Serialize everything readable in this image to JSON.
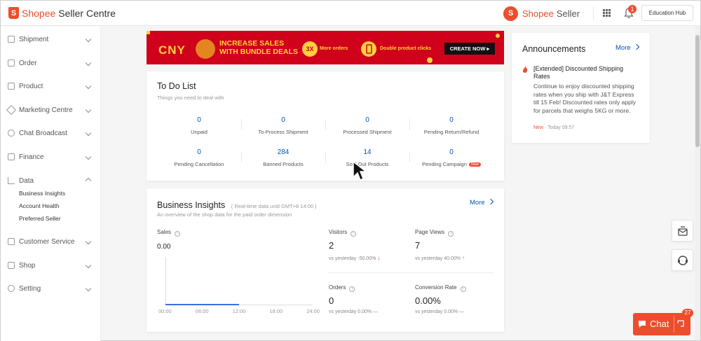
{
  "header": {
    "brand_word": "Shopee",
    "brand_suffix": "Seller Centre",
    "brand_logo_letter": "S",
    "center_brand_word": "Shopee",
    "center_brand_suffix": "Seller",
    "notification_count": "1",
    "education_hub_label": "Education Hub"
  },
  "sidebar": {
    "items": [
      {
        "label": "Shipment",
        "icon": "shipment-icon"
      },
      {
        "label": "Order",
        "icon": "order-icon"
      },
      {
        "label": "Product",
        "icon": "product-icon"
      },
      {
        "label": "Marketing Centre",
        "icon": "marketing-icon"
      },
      {
        "label": "Chat Broadcast",
        "icon": "chat-broadcast-icon"
      },
      {
        "label": "Finance",
        "icon": "finance-icon"
      },
      {
        "label": "Data",
        "icon": "data-icon",
        "expanded": true
      },
      {
        "label": "Customer Service",
        "icon": "customer-service-icon"
      },
      {
        "label": "Shop",
        "icon": "shop-icon"
      },
      {
        "label": "Setting",
        "icon": "setting-icon"
      }
    ],
    "data_sub_items": [
      "Business Insights",
      "Account Health",
      "Preferred Seller"
    ]
  },
  "banner": {
    "cny": "CNY",
    "headline_line1": "INCREASE SALES",
    "headline_line2": "WITH BUNDLE DEALS",
    "badge_3x": "3X",
    "more_orders": "More orders",
    "double_clicks": "Double product clicks",
    "cta": "CREATE NOW ▸"
  },
  "todo": {
    "title": "To Do List",
    "subtitle": "Things you need to deal with",
    "items": [
      {
        "count": "0",
        "label": "Unpaid"
      },
      {
        "count": "0",
        "label": "To-Process Shipment"
      },
      {
        "count": "0",
        "label": "Processed Shipment"
      },
      {
        "count": "0",
        "label": "Pending Return/Refund"
      },
      {
        "count": "0",
        "label": "Pending Cancellation"
      },
      {
        "count": "284",
        "label": "Banned Products"
      },
      {
        "count": "14",
        "label": "Sold Out Products"
      },
      {
        "count": "0",
        "label": "Pending Campaign",
        "tag": "New"
      }
    ]
  },
  "insights": {
    "title": "Business Insights",
    "realtime": "( Real-time data until GMT+8 14:00 )",
    "subtitle": "An overview of the shop data for the paid order dimension",
    "more_label": "More",
    "sales_label": "Sales",
    "sales_value": "0.00",
    "time_ticks": [
      "00:00",
      "06:00",
      "12:00",
      "18:00",
      "24:00"
    ],
    "metrics": [
      {
        "label": "Visitors",
        "value": "2",
        "vs": "vs yesterday -50.00%",
        "trend": "down"
      },
      {
        "label": "Page Views",
        "value": "7",
        "vs": "vs yesterday 40.00%",
        "trend": "up"
      },
      {
        "label": "Orders",
        "value": "0",
        "vs": "vs yesterday 0.00% —",
        "trend": "flat"
      },
      {
        "label": "Conversion Rate",
        "value": "0.00%",
        "vs": "vs yesterday 0.00% —",
        "trend": "flat"
      }
    ]
  },
  "announcements": {
    "title": "Announcements",
    "more_label": "More",
    "item_title": "[Extended] Discounted Shipping Rates",
    "item_body": "Continue to enjoy discounted shipping rates when you ship with J&T Express till 15 Feb! Discounted rates only apply for parcels that weighs 5KG or more.",
    "item_tag": "New",
    "item_date": "· Today 09:57"
  },
  "chat": {
    "label": "Chat",
    "unread": "27"
  },
  "colors": {
    "brand": "#ee4d2d",
    "link": "#0055b8",
    "banner_red": "#d0011b",
    "banner_gold": "#ffd23f"
  }
}
